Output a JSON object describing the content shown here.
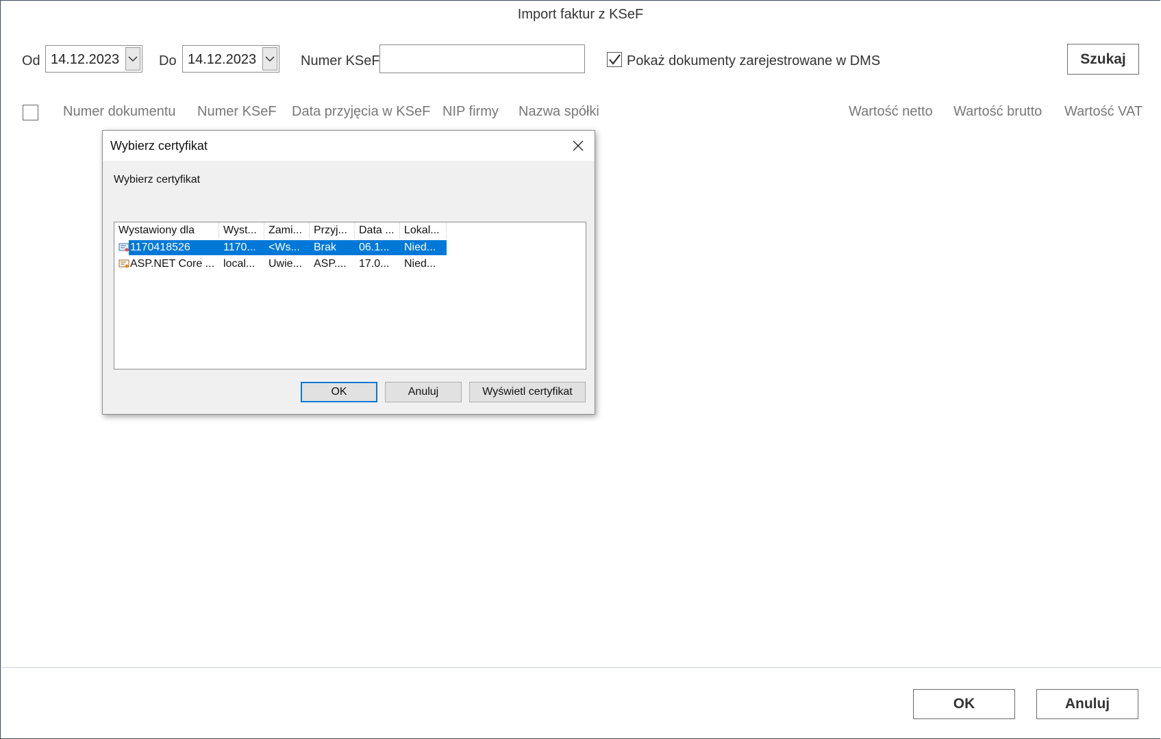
{
  "window": {
    "title": "Import faktur z KSeF"
  },
  "filters": {
    "from_label": "Od",
    "from_value": "14.12.2023",
    "to_label": "Do",
    "to_value": "14.12.2023",
    "ksef_label": "Numer KSeF",
    "ksef_value": "",
    "show_registered_label": "Pokaż dokumenty zarejestrowane w DMS",
    "show_registered_checked": true,
    "search_button": "Szukaj"
  },
  "table": {
    "columns": [
      "Numer dokumentu",
      "Numer KSeF",
      "Data przyjęcia w KSeF",
      "NIP firmy",
      "Nazwa spółki",
      "Wartość netto",
      "Wartość brutto",
      "Wartość VAT"
    ]
  },
  "footer": {
    "ok_button": "OK",
    "cancel_button": "Anuluj"
  },
  "dialog": {
    "title": "Wybierz certyfikat",
    "subtitle": "Wybierz certyfikat",
    "columns": [
      "Wystawiony dla",
      "Wyst...",
      "Zami...",
      "Przyj...",
      "Data ...",
      "Lokal..."
    ],
    "rows": [
      {
        "cells": [
          "1170418526",
          "1170...",
          "<Ws...",
          "Brak",
          "06.1...",
          "Nied..."
        ],
        "selected": true
      },
      {
        "cells": [
          "ASP.NET Core ...",
          "local...",
          "Uwie...",
          "ASP....",
          "17.0...",
          "Nied..."
        ],
        "selected": false
      }
    ],
    "ok_button": "OK",
    "cancel_button": "Anuluj",
    "view_button": "Wyświetl certyfikat"
  },
  "colors": {
    "selection": "#0078d7",
    "primary_border": "#0078d7"
  },
  "icons": [
    "chevron-down-icon",
    "checkmark-icon",
    "close-icon",
    "certificate-icon"
  ]
}
